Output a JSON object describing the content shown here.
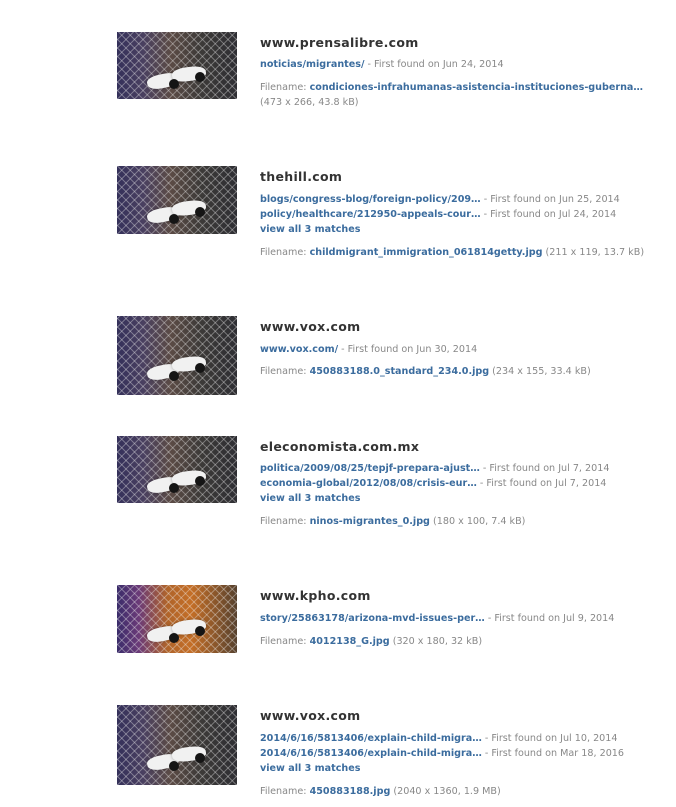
{
  "results": [
    {
      "site": "www.prensalibre.com",
      "matches": [
        {
          "link": "noticias/migrantes/",
          "meta": " - First found on Jun 24, 2014"
        }
      ],
      "view_all": "",
      "filename_label": "Filename:",
      "filename": "condiciones-infrahumanas-asistencia-instituciones-guberna…",
      "filename_meta": "(473 x 266, 43.8 kB)"
    },
    {
      "site": "thehill.com",
      "matches": [
        {
          "link": "blogs/congress-blog/foreign-policy/209…",
          "meta": " - First found on Jun 25, 2014"
        },
        {
          "link": "policy/healthcare/212950-appeals-cour…",
          "meta": " - First found on Jul 24, 2014"
        }
      ],
      "view_all": "view all 3 matches",
      "filename_label": "Filename:",
      "filename": "childmigrant_immigration_061814getty.jpg",
      "filename_meta": "(211 x 119, 13.7 kB)"
    },
    {
      "site": "www.vox.com",
      "matches": [
        {
          "link": "www.vox.com/",
          "meta": " - First found on Jun 30, 2014"
        }
      ],
      "view_all": "",
      "filename_label": "Filename:",
      "filename": "450883188.0_standard_234.0.jpg",
      "filename_meta": "(234 x 155, 33.4 kB)"
    },
    {
      "site": "eleconomista.com.mx",
      "matches": [
        {
          "link": "politica/2009/08/25/tepjf-prepara-ajust…",
          "meta": " - First found on Jul 7, 2014"
        },
        {
          "link": "economia-global/2012/08/08/crisis-eur…",
          "meta": " - First found on Jul 7, 2014"
        }
      ],
      "view_all": "view all 3 matches",
      "filename_label": "Filename:",
      "filename": "ninos-migrantes_0.jpg",
      "filename_meta": "(180 x 100, 7.4 kB)"
    },
    {
      "site": "www.kpho.com",
      "matches": [
        {
          "link": "story/25863178/arizona-mvd-issues-per…",
          "meta": " - First found on Jul 9, 2014"
        }
      ],
      "view_all": "",
      "filename_label": "Filename:",
      "filename": "4012138_G.jpg",
      "filename_meta": "(320 x 180, 32 kB)"
    },
    {
      "site": "www.vox.com",
      "matches": [
        {
          "link": "2014/6/16/5813406/explain-child-migra…",
          "meta": " - First found on Jul 10, 2014"
        },
        {
          "link": "2014/6/16/5813406/explain-child-migra…",
          "meta": " - First found on Mar 18, 2016"
        }
      ],
      "view_all": "view all 3 matches",
      "filename_label": "Filename:",
      "filename": "450883188.jpg",
      "filename_meta": "(2040 x 1360, 1.9 MB)"
    }
  ]
}
